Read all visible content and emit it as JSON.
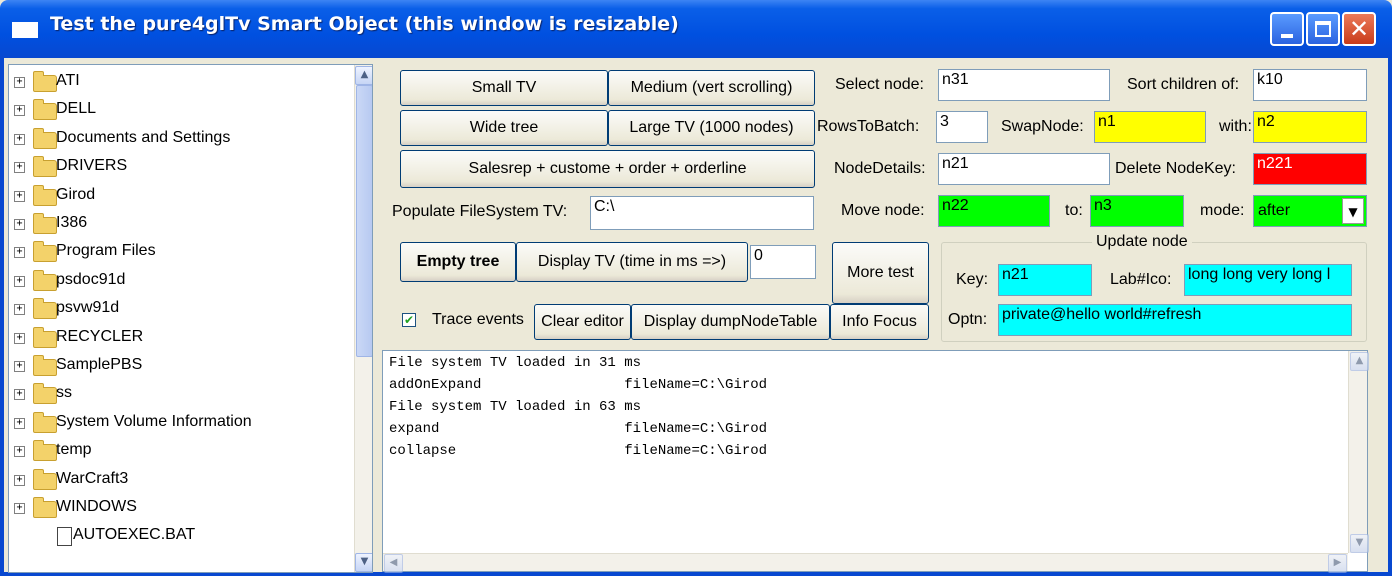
{
  "window": {
    "title": "Test the pure4glTv Smart Object   (this window is resizable)",
    "minimize_label": "_",
    "maximize_label": "□",
    "close_label": "✕"
  },
  "tree": {
    "items": [
      {
        "label": "ATI",
        "icon": "folder-icon",
        "expandable": true
      },
      {
        "label": "DELL",
        "icon": "folder-icon",
        "expandable": true
      },
      {
        "label": "Documents and Settings",
        "icon": "folder-icon",
        "expandable": true
      },
      {
        "label": "DRIVERS",
        "icon": "folder-icon",
        "expandable": true
      },
      {
        "label": "Girod",
        "icon": "folder-icon",
        "expandable": true
      },
      {
        "label": "I386",
        "icon": "folder-icon",
        "expandable": true
      },
      {
        "label": "Program Files",
        "icon": "folder-icon",
        "expandable": true
      },
      {
        "label": "psdoc91d",
        "icon": "folder-icon",
        "expandable": true
      },
      {
        "label": "psvw91d",
        "icon": "folder-icon",
        "expandable": true
      },
      {
        "label": "RECYCLER",
        "icon": "folder-icon",
        "expandable": true
      },
      {
        "label": "SamplePBS",
        "icon": "folder-icon",
        "expandable": true
      },
      {
        "label": "ss",
        "icon": "folder-icon",
        "expandable": true
      },
      {
        "label": "System Volume Information",
        "icon": "folder-icon",
        "expandable": true
      },
      {
        "label": "temp",
        "icon": "folder-icon",
        "expandable": true
      },
      {
        "label": "WarCraft3",
        "icon": "folder-icon",
        "expandable": true
      },
      {
        "label": "WINDOWS",
        "icon": "folder-icon",
        "expandable": true
      },
      {
        "label": "AUTOEXEC.BAT",
        "icon": "file-icon",
        "expandable": false
      }
    ]
  },
  "buttons": {
    "small_tv": "Small TV",
    "medium": "Medium (vert scrolling)",
    "wide_tree": "Wide tree",
    "large_tv": "Large TV (1000 nodes)",
    "salesrep": "Salesrep + custome + order + orderline",
    "empty_tree": "Empty tree",
    "display_tv": "Display TV  (time in ms =>)",
    "more_test": "More test",
    "clear_editor": "Clear editor",
    "dump_node_table": "Display dumpNodeTable",
    "info_focus": "Info Focus"
  },
  "fields": {
    "populate_label": "Populate FileSystem TV:",
    "populate_value": "C:\\",
    "time_value": "0",
    "trace_label": "Trace events",
    "trace_checked": true,
    "select_node_label": "Select node:",
    "select_node_value": "n31",
    "sort_children_label": "Sort children of:",
    "sort_children_value": "k10",
    "rows_to_batch_label": "RowsToBatch:",
    "rows_to_batch_value": "3",
    "swap_node_label": "SwapNode:",
    "swap_node_value": "n1",
    "with_label": "with:",
    "with_value": "n2",
    "node_details_label": "NodeDetails:",
    "node_details_value": "n21",
    "delete_nodekey_label": "Delete NodeKey:",
    "delete_nodekey_value": "n221",
    "move_node_label": "Move node:",
    "move_node_value": "n22",
    "to_label": "to:",
    "to_value": "n3",
    "mode_label": "mode:",
    "mode_value": "after"
  },
  "update_node": {
    "title": "Update node",
    "key_label": "Key:",
    "key_value": "n21",
    "labico_label": "Lab#Ico:",
    "labico_value": "long long very long l",
    "optn_label": "Optn:",
    "optn_value": "private@hello world#refresh"
  },
  "editor": {
    "lines": [
      "File system TV loaded in 31 ms",
      "addOnExpand                 fileName=C:\\Girod",
      "File system TV loaded in 63 ms",
      "expand                      fileName=C:\\Girod",
      "collapse                    fileName=C:\\Girod"
    ]
  },
  "colors": {
    "yellow": "#ffff00",
    "green": "#00ff00",
    "red": "#ff0000",
    "cyan": "#00ffff",
    "titlebar": "#0050e0"
  }
}
